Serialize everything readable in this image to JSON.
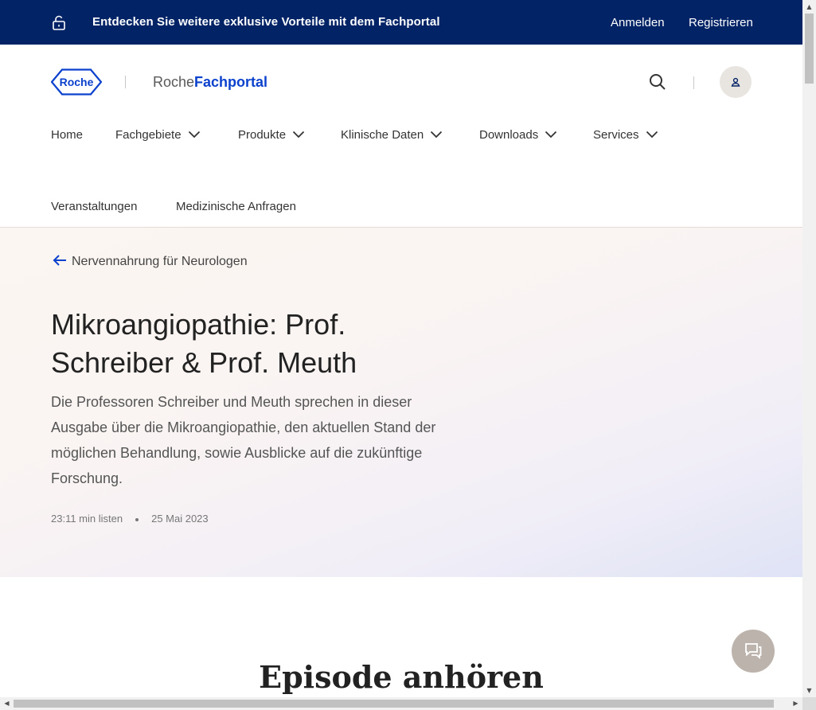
{
  "topbar": {
    "promo": "Entdecken Sie weitere exklusive Vorteile mit dem Fachportal",
    "login": "Anmelden",
    "register": "Registrieren",
    "icon": "lock-icon"
  },
  "header": {
    "logo_text": "Roche",
    "portal_a": "Roche",
    "portal_b": "Fachportal",
    "icons": [
      "search-icon",
      "user-icon"
    ],
    "brand_color": "#0b41cd"
  },
  "nav": {
    "items": [
      {
        "label": "Home",
        "dropdown": false
      },
      {
        "label": "Fachgebiete",
        "dropdown": true
      },
      {
        "label": "Produkte",
        "dropdown": true
      },
      {
        "label": "Klinische Daten",
        "dropdown": true
      },
      {
        "label": "Downloads",
        "dropdown": true
      },
      {
        "label": "Services",
        "dropdown": true
      },
      {
        "label": "Veranstaltungen",
        "dropdown": false
      },
      {
        "label": "Medizinische Anfragen",
        "dropdown": false
      }
    ]
  },
  "hero": {
    "back_label": "Nervennahrung für Neurologen",
    "title": "Mikroangiopathie: Prof. Schreiber & Prof. Meuth",
    "description": "Die Professoren Schreiber und Meuth sprechen in dieser Ausgabe über die Mikroangiopathie, den aktuellen Stand der möglichen Behandlung, sowie Ausblicke auf die zukünftige Forschung.",
    "duration": "23:11 min listen",
    "date": "25 Mai 2023"
  },
  "episode": {
    "heading": "Episode anhören"
  },
  "colors": {
    "topbar_bg": "#022366",
    "accent": "#0b41cd",
    "chat_bg": "#bdb3ad"
  }
}
